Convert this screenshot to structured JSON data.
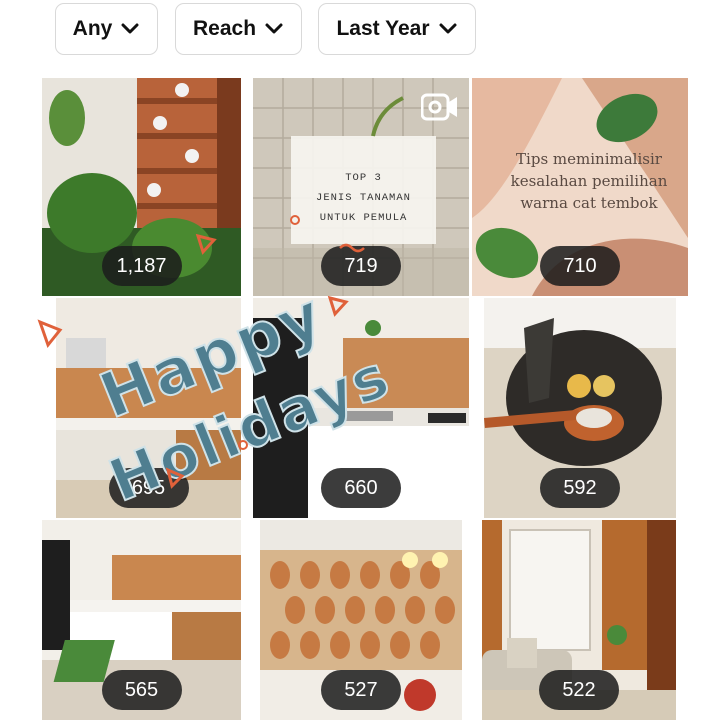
{
  "filters": [
    {
      "label": "Any"
    },
    {
      "label": "Reach"
    },
    {
      "label": "Last Year"
    }
  ],
  "posts": [
    {
      "count": "1,187",
      "theme": "garden wall with potted plants"
    },
    {
      "count": "719",
      "theme": "video: top 3 plants",
      "text_lines": [
        "TOP 3",
        "JENIS TANAMAN",
        "UNTUK PEMULA"
      ]
    },
    {
      "count": "710",
      "theme": "paint tips",
      "text_lines": [
        "Tips meminimalisir",
        "kesalahan pemilihan",
        "warna cat tembok"
      ]
    },
    {
      "count": "695",
      "theme": "kitchen"
    },
    {
      "count": "660",
      "theme": "kitchen sink"
    },
    {
      "count": "592",
      "theme": "stone mortar"
    },
    {
      "count": "565",
      "theme": "kitchen"
    },
    {
      "count": "527",
      "theme": "kitchen tiles"
    },
    {
      "count": "522",
      "theme": "living room"
    }
  ],
  "overlay": {
    "line1": "Happy",
    "line2": "Holidays"
  },
  "colors": {
    "count_badge": "#1c1c1c",
    "holiday_text": "#4f7e90",
    "accent_terracotta": "#d9a78a"
  },
  "icons": {
    "dropdown": "chevron-down-icon",
    "video": "video-camera-icon"
  }
}
